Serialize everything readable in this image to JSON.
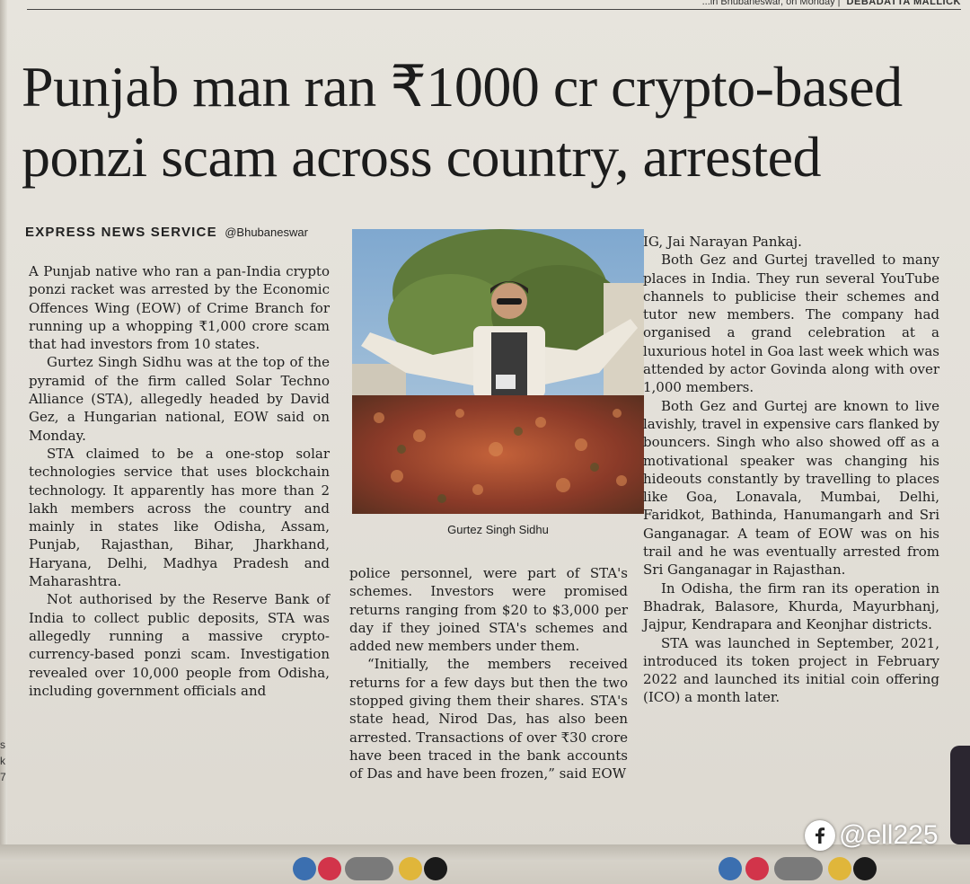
{
  "top_strip": {
    "caption_fragment": "...in Bhubaneswar, on Monday",
    "photo_credit": "DEBADATTA MALLICK"
  },
  "headline": "Punjab man ran ₹1000 cr crypto-based ponzi scam across country, arrested",
  "byline": {
    "service": "EXPRESS NEWS SERVICE",
    "location": "@Bhubaneswar"
  },
  "photo": {
    "caption": "Gurtez Singh Sidhu"
  },
  "article": {
    "col1": [
      "A Punjab native who ran a pan-India crypto ponzi racket was arrested by the Economic Offences Wing (EOW) of Crime Branch for running up a whopping ₹1,000 crore scam that had investors from 10 states.",
      "Gurtez Singh Sidhu was at the top of the pyramid of the firm called Solar Techno Alliance (STA), allegedly headed by David Gez, a Hungarian national, EOW said on Monday.",
      "STA claimed to be a one-stop solar technologies service that uses blockchain technology. It apparently has more than 2 lakh members across the country and mainly in states like Odisha, Assam, Punjab, Rajasthan, Bihar, Jharkhand, Haryana, Delhi, Madhya Pradesh and Maharashtra.",
      "Not authorised by the Reserve Bank of India to collect public deposits, STA was allegedly running a massive crypto-currency-based ponzi scam. Investigation revealed over 10,000 people from Odisha, including government officials and"
    ],
    "col2": [
      "police personnel, were part of STA's schemes. Investors were promised returns ranging from $20 to $3,000 per day if they joined STA's schemes and added new members under them.",
      "“Initially, the members received returns for a few days but then the two stopped giving them their shares. STA's state head, Nirod Das, has also been arrested. Transactions of over ₹30 crore have been traced in the bank accounts of Das and have been frozen,” said EOW"
    ],
    "col3": [
      "IG, Jai Narayan Pankaj.",
      "Both Gez and Gurtej travelled to many places in India. They run several YouTube channels to publicise their schemes and tutor new members. The company had organised a grand celebration at a luxurious hotel in Goa last week which was attended by actor Govinda along with over 1,000 members.",
      "Both Gez and Gurtej are known to live lavishly, travel in expensive cars flanked by bouncers. Singh who also showed off as a motivational speaker was changing his hideouts constantly by travelling to places like Goa, Lonavala, Mumbai, Delhi, Faridkot, Bathinda, Hanumangarh and Sri Ganganagar. A team of EOW was on his trail and he was eventually arrested from Sri Ganganagar in Rajasthan.",
      "In Odisha, the firm ran its operation in Bhadrak, Balasore, Khurda, Mayurbhanj, Jajpur, Kendrapara and Keonjhar districts.",
      "STA was launched in September, 2021, introduced its token project in February 2022 and launched its initial coin offering (ICO) a month later."
    ]
  },
  "margin_fragment": [
    "s",
    "k",
    "7"
  ],
  "watermark": {
    "icon": "facebook-icon",
    "handle": "@ell225"
  },
  "colors": {
    "paper": "#e5e2db",
    "ink": "#1e1e1e",
    "registration_dots": [
      "#3b6fb0",
      "#d2344a",
      "#7a7a7a",
      "#e0b63a",
      "#1a1a1a"
    ]
  }
}
